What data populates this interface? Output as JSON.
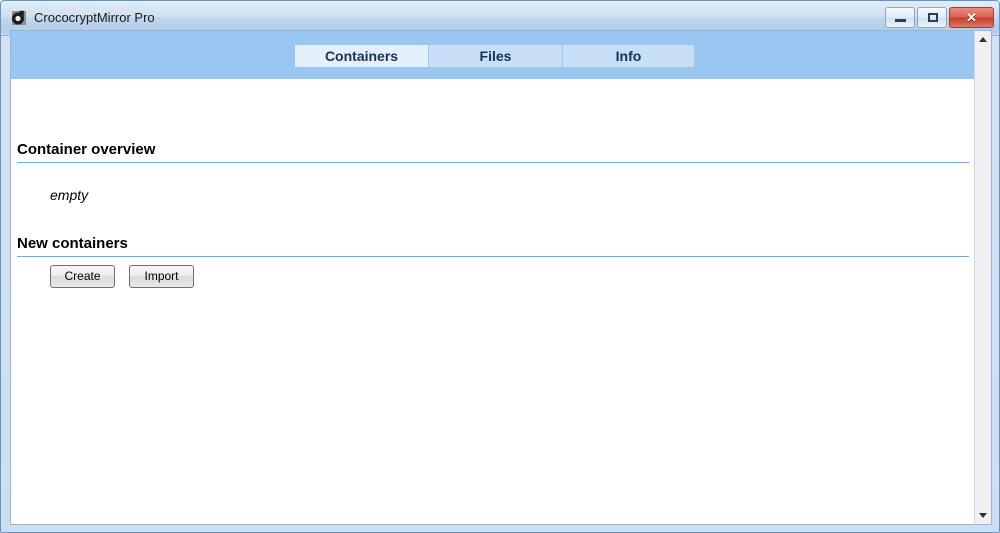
{
  "window": {
    "title": "CrococryptMirror Pro",
    "icon": "app-logo-icon",
    "controls": {
      "minimize_label": "",
      "maximize_label": "",
      "close_label": "✕"
    }
  },
  "tabs": [
    {
      "label": "Containers",
      "active": true
    },
    {
      "label": "Files",
      "active": false
    },
    {
      "label": "Info",
      "active": false
    }
  ],
  "sections": {
    "container_overview": {
      "heading": "Container overview",
      "empty_text": "empty"
    },
    "new_containers": {
      "heading": "New containers",
      "buttons": [
        {
          "label": "Create"
        },
        {
          "label": "Import"
        }
      ]
    }
  },
  "scrollbar": {
    "up_arrow": "scroll-up-icon",
    "down_arrow": "scroll-down-icon"
  },
  "colors": {
    "banner": "#9ac7f2",
    "tab_active": "#e3f0fc",
    "tab_inactive": "#c6dff7",
    "rule": "#74aade",
    "close_button": "#c43e2c"
  }
}
